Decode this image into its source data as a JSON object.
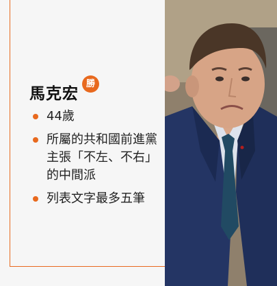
{
  "candidate": {
    "name": "馬克宏",
    "badge": "勝"
  },
  "points": [
    "44歲",
    "所屬的共和國前進黨主張「不左、不右」的中間派",
    "列表文字最多五筆"
  ],
  "colors": {
    "accent": "#e8691e",
    "background": "#f6f6f6",
    "text": "#111111"
  }
}
